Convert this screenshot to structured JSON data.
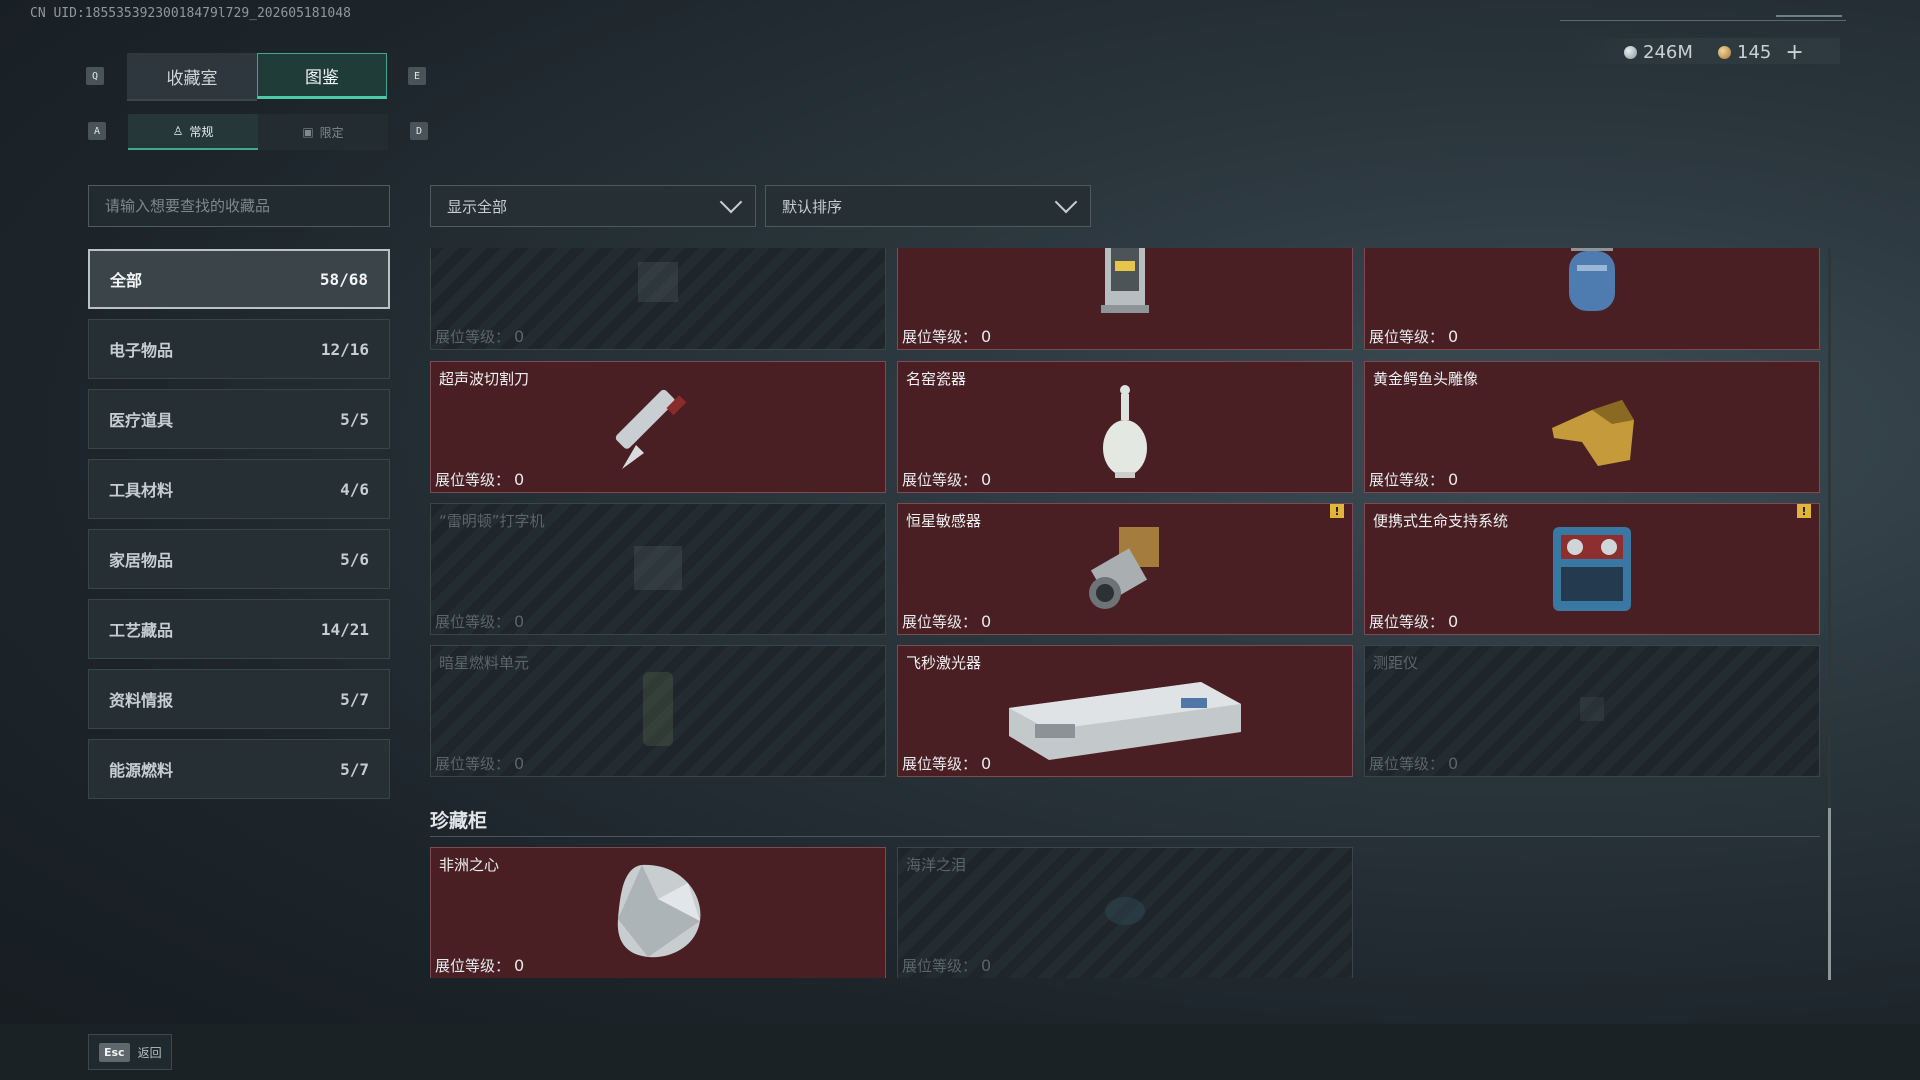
{
  "uid": "CN UID:18553539230018479l729_202605181048",
  "currency": [
    {
      "icon": "silver-coin-icon",
      "value": "246M"
    },
    {
      "icon": "gold-coin-icon",
      "value": "145",
      "has_plus": true
    }
  ],
  "tabs": {
    "key_left": "Q",
    "key_right": "E",
    "items": [
      {
        "label": "收藏室",
        "active": false
      },
      {
        "label": "图鉴",
        "active": true
      }
    ]
  },
  "subtabs": {
    "key_left": "A",
    "key_right": "D",
    "items": [
      {
        "label": "常规",
        "active": true
      },
      {
        "label": "限定",
        "active": false
      }
    ]
  },
  "search": {
    "placeholder": "请输入想要查找的收藏品",
    "value": ""
  },
  "categories": [
    {
      "label": "全部",
      "count": "58/68",
      "active": true
    },
    {
      "label": "电子物品",
      "count": "12/16"
    },
    {
      "label": "医疗道具",
      "count": "5/5"
    },
    {
      "label": "工具材料",
      "count": "4/6"
    },
    {
      "label": "家居物品",
      "count": "5/6"
    },
    {
      "label": "工艺藏品",
      "count": "14/21"
    },
    {
      "label": "资料情报",
      "count": "5/7"
    },
    {
      "label": "能源燃料",
      "count": "5/7"
    }
  ],
  "filters": {
    "show": "显示全部",
    "sort": "默认排序"
  },
  "level_label": "展位等级：",
  "grid": [
    {
      "name": "",
      "level": "0",
      "owned": false,
      "icon": "unknown-item-icon"
    },
    {
      "name": "",
      "level": "0",
      "owned": true,
      "icon": "lantern-icon"
    },
    {
      "name": "",
      "level": "0",
      "owned": true,
      "icon": "gas-canister-icon"
    },
    {
      "name": "超声波切割刀",
      "level": "0",
      "owned": true,
      "icon": "cutting-knife-icon"
    },
    {
      "name": "名窑瓷器",
      "level": "0",
      "owned": true,
      "icon": "porcelain-vase-icon"
    },
    {
      "name": "黄金鳄鱼头雕像",
      "level": "0",
      "owned": true,
      "icon": "gold-crocodile-icon"
    },
    {
      "name": "“雷明顿”打字机",
      "level": "0",
      "owned": false,
      "icon": "typewriter-icon"
    },
    {
      "name": "恒星敏感器",
      "level": "0",
      "owned": true,
      "icon": "star-sensor-icon",
      "warn": true
    },
    {
      "name": "便携式生命支持系统",
      "level": "0",
      "owned": true,
      "icon": "life-support-icon",
      "warn": true
    },
    {
      "name": "暗星燃料单元",
      "level": "0",
      "owned": false,
      "icon": "fuel-cell-icon"
    },
    {
      "name": "飞秒激光器",
      "level": "0",
      "owned": true,
      "icon": "laser-device-icon"
    },
    {
      "name": "测距仪",
      "level": "0",
      "owned": false,
      "icon": "rangefinder-icon"
    }
  ],
  "section": {
    "title": "珍藏柜",
    "items": [
      {
        "name": "非洲之心",
        "level": "0",
        "owned": true,
        "icon": "diamond-icon"
      },
      {
        "name": "海洋之泪",
        "level": "0",
        "owned": false,
        "icon": "gem-icon"
      }
    ]
  },
  "footer": {
    "key": "Esc",
    "label": "返回"
  }
}
